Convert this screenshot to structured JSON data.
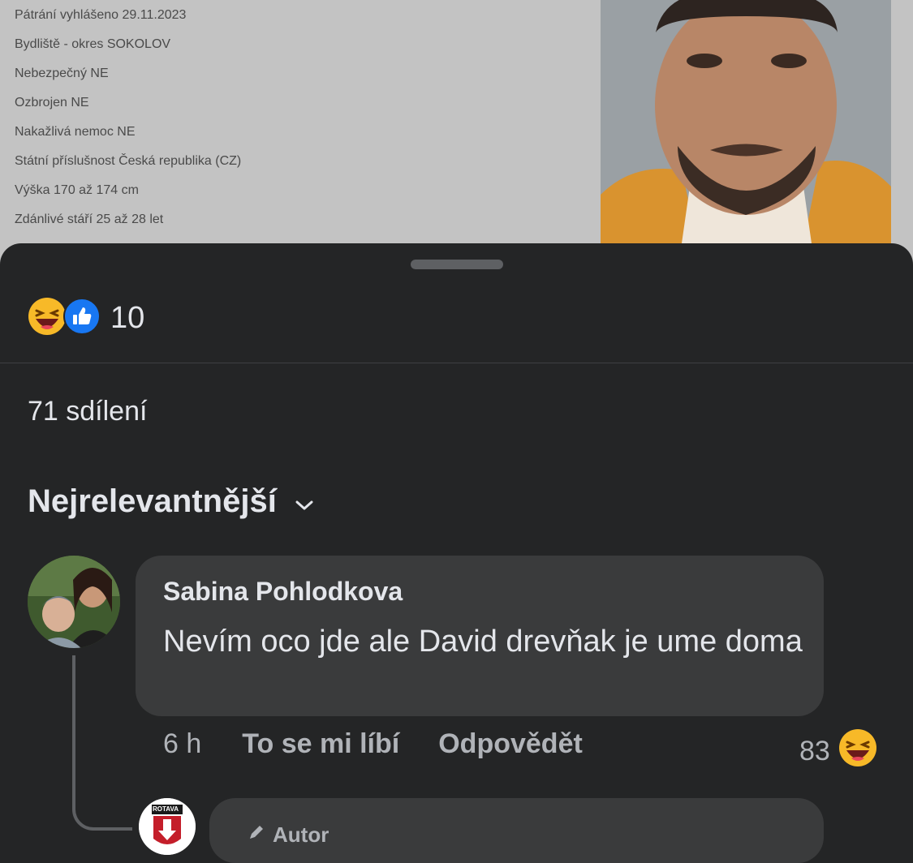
{
  "wanted_info": {
    "lines": [
      "Pátrání vyhlášeno 29.11.2023",
      "Bydliště - okres SOKOLOV",
      "Nebezpečný NE",
      "Ozbrojen NE",
      "Nakažlivá nemoc NE",
      "Státní příslušnost Česká republika (CZ)",
      "Výška 170 až 174 cm",
      "Zdánlivé stáří 25 až 28 let"
    ]
  },
  "reactions": {
    "icons": [
      "laugh-emoji-icon",
      "like-icon"
    ],
    "count": "10"
  },
  "shares": "71 sdílení",
  "sort": {
    "label": "Nejrelevantnější",
    "icon": "chevron-down-icon"
  },
  "comment": {
    "author": "Sabina Pohlodkova",
    "text": "Nevím oco jde ale David drevňak je ume doma",
    "time": "6 h",
    "like_label": "To se mi líbí",
    "reply_label": "Odpovědět",
    "reaction_count": "83"
  },
  "reply": {
    "avatar_text": "ROTAVA",
    "badge": "Autor"
  },
  "colors": {
    "sheet_bg": "#242526",
    "bubble_bg": "#3a3b3c",
    "text": "#e4e6eb",
    "muted": "#b0b3b8",
    "like_blue": "#1877f2",
    "emoji_yellow": "#f7b928"
  }
}
